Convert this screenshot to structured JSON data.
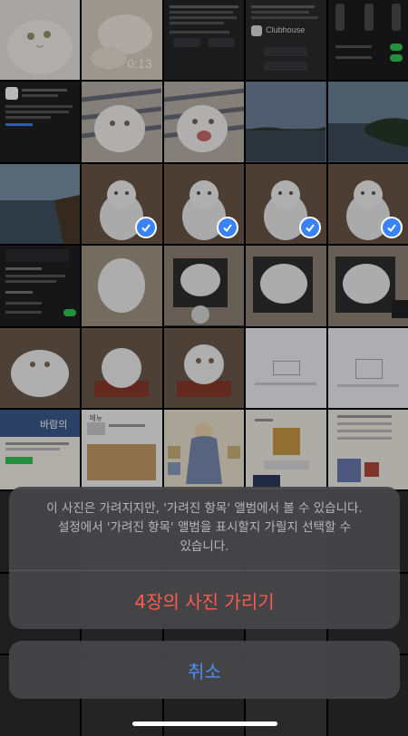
{
  "photo_grid": {
    "video_duration": "0:13",
    "tile_texts": {
      "clubhouse_title": "Clubhouse",
      "sauna_brand": "바람의",
      "settings_header": "메뉴"
    }
  },
  "hide_sheet": {
    "message_lines": [
      "이 사진은 가려지지만, '가려진 항목' 앨범에서 볼 수 있습니다.",
      "설정에서 '가려진 항목' 앨범을 표시할지 가릴지 선택할 수",
      "있습니다."
    ],
    "hide_button_label": "4장의 사진 가리기",
    "cancel_button_label": "취소"
  },
  "colors": {
    "destructive": "#ff5a4c",
    "accent": "#4a8ef5",
    "selection_check": "#3a82f7"
  }
}
